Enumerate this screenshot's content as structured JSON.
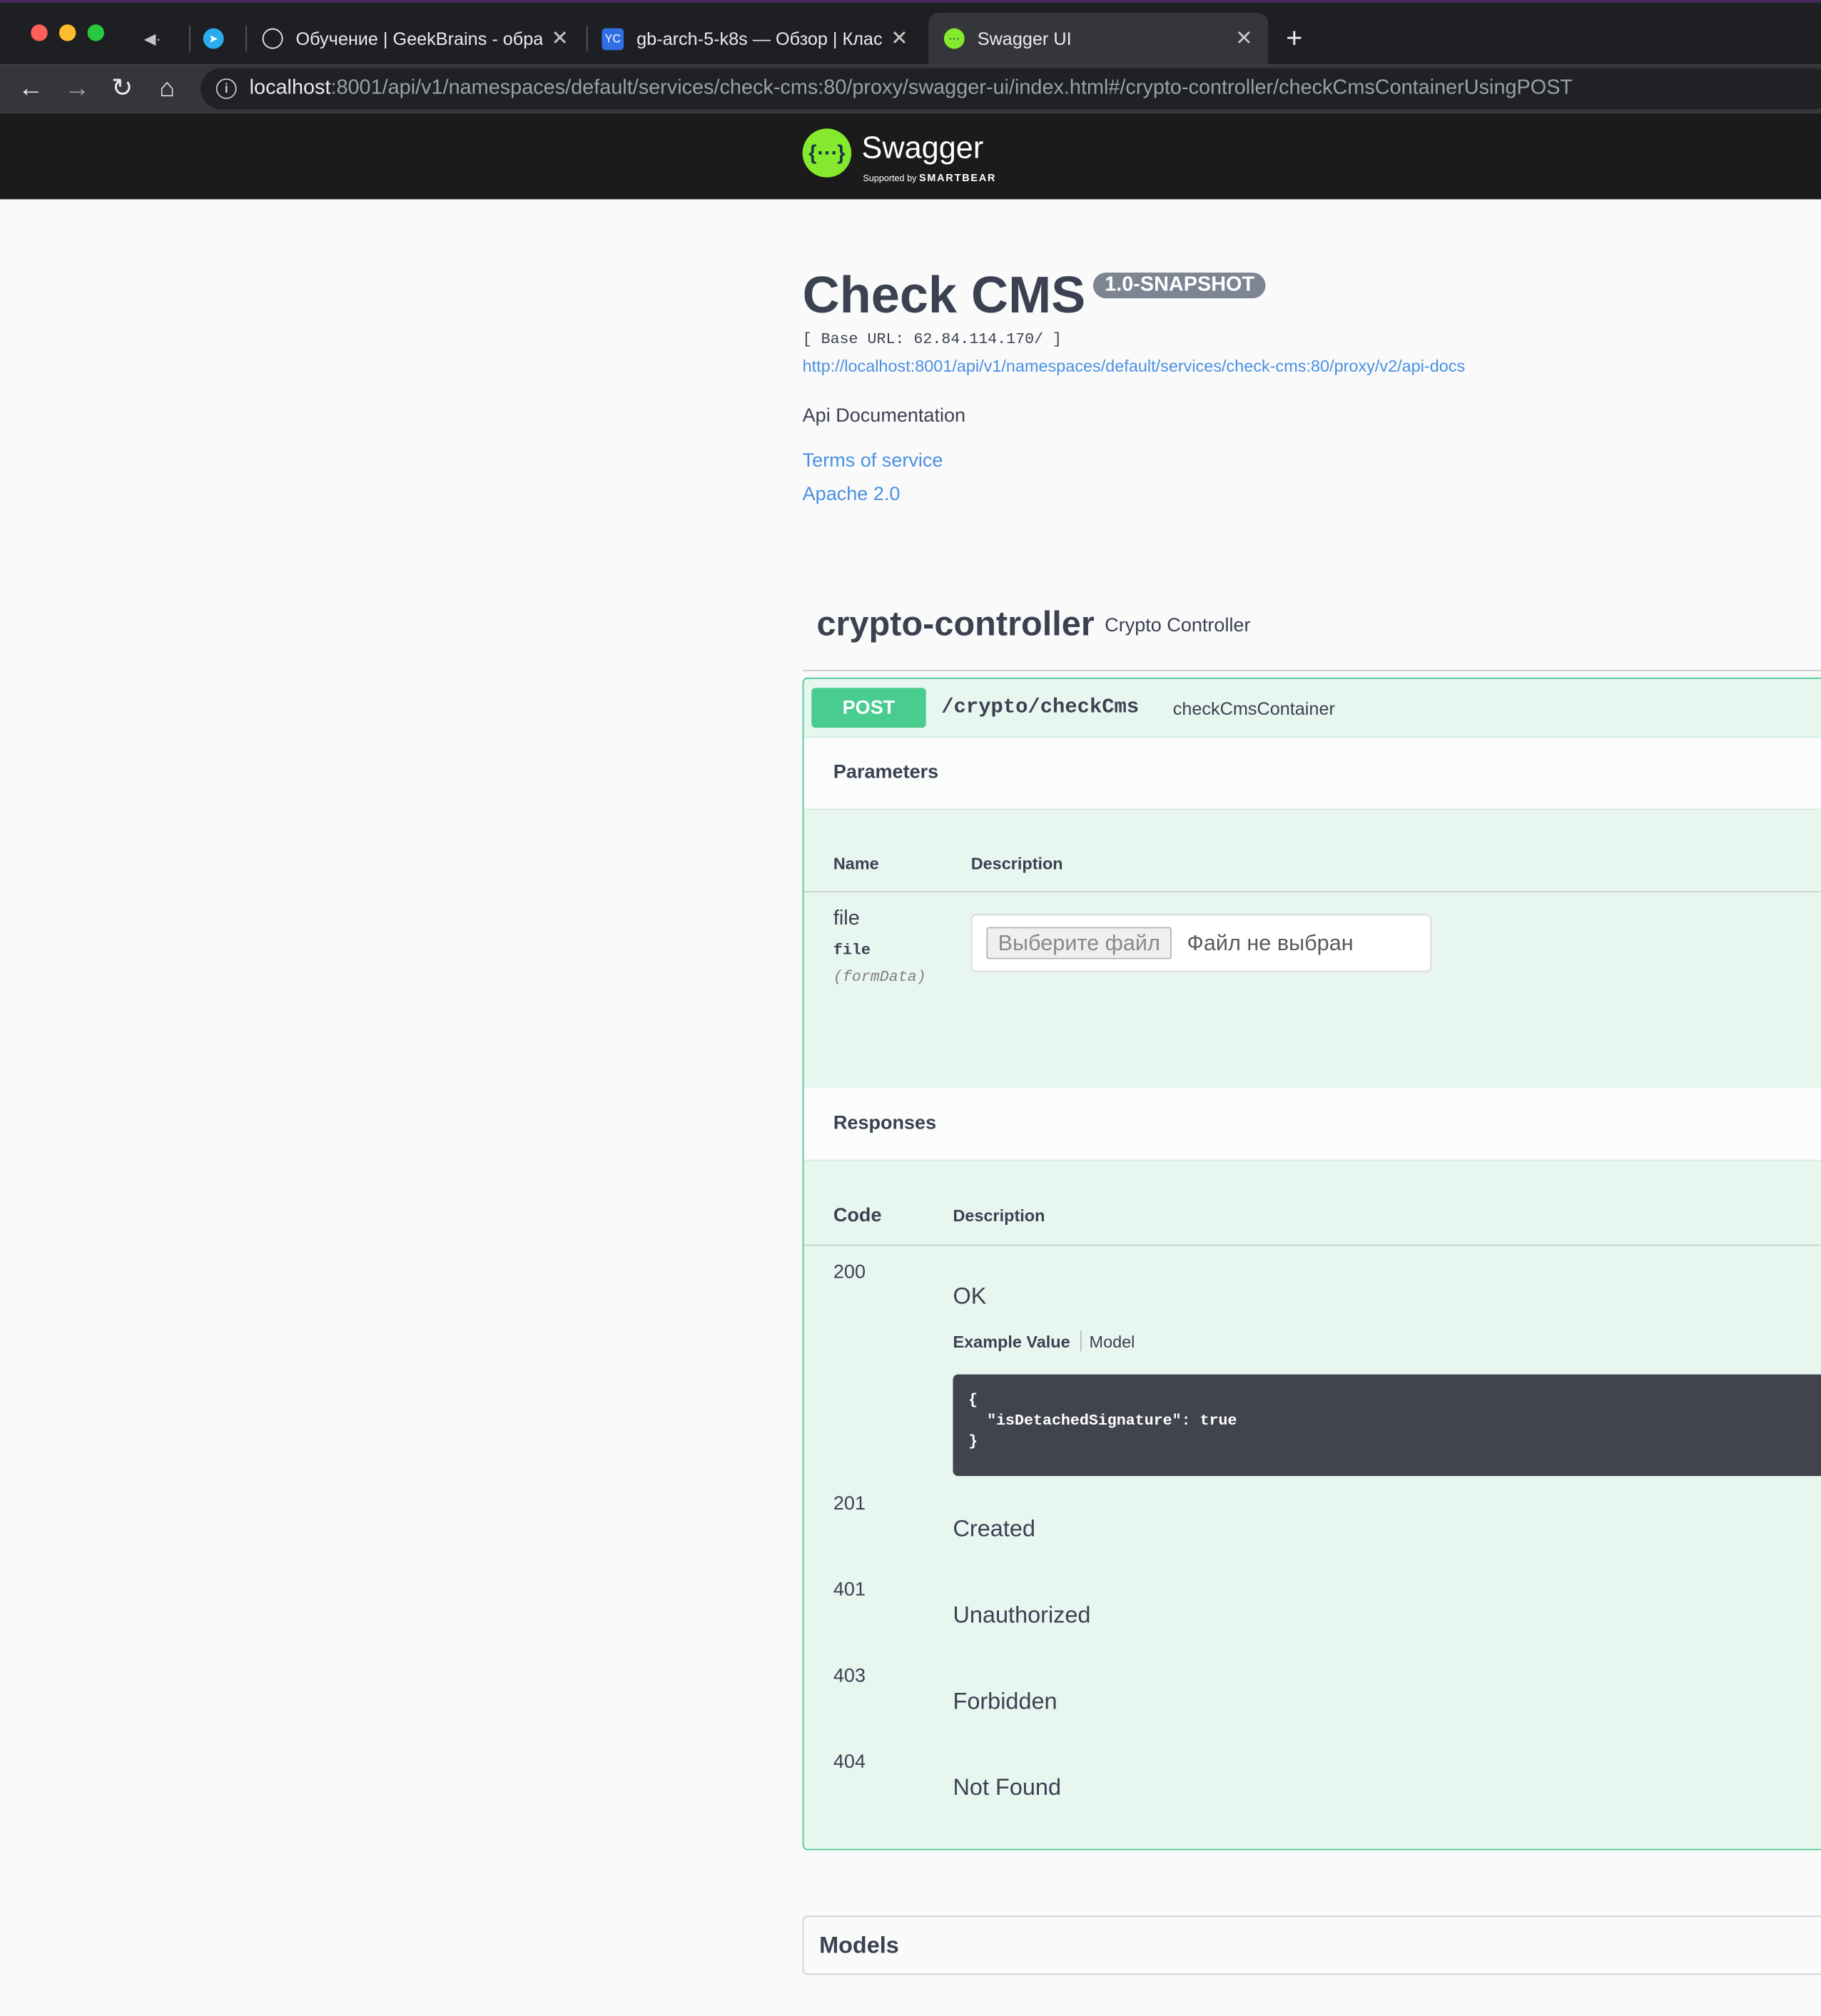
{
  "browser": {
    "tabs": [
      {
        "label": "",
        "icon": "speaker-icon"
      },
      {
        "label": "",
        "icon": "telegram-icon"
      },
      {
        "label": "Обучение | GeekBrains - обра",
        "icon": "openai-icon"
      },
      {
        "label": "gb-arch-5-k8s — Обзор | Клас",
        "icon": "yc-icon",
        "icon_text": "YC"
      },
      {
        "label": "Swagger UI",
        "icon": "swagger-icon",
        "active": true
      }
    ],
    "new_tab": "+",
    "url_host": "localhost",
    "url_path": ":8001/api/v1/namespaces/default/services/check-cms:80/proxy/swagger-ui/index.html#/crypto-controller/checkCmsContainerUsingPOST"
  },
  "topbar": {
    "logo_text": "Swagger",
    "logo_sub_prefix": "Supported by",
    "logo_sub_brand": "SMARTBEAR"
  },
  "info": {
    "title": "Check CMS",
    "version": "1.0-SNAPSHOT",
    "base_url": "[ Base URL: 62.84.114.170/ ]",
    "docs_url": "http://localhost:8001/api/v1/namespaces/default/services/check-cms:80/proxy/v2/api-docs",
    "description": "Api Documentation",
    "terms": "Terms of service",
    "license": "Apache 2.0"
  },
  "tag": {
    "name": "crypto-controller",
    "description": "Crypto Controller"
  },
  "operation": {
    "method": "POST",
    "path": "/crypto/checkCms",
    "summary": "checkCmsContainer",
    "parameters_title": "Parameters",
    "col_name": "Name",
    "col_description": "Description",
    "param": {
      "name": "file",
      "type": "file",
      "in": "(formData)",
      "button": "Выберите файл",
      "no_file": "Файл не выбран"
    },
    "responses_title": "Responses",
    "col_code": "Code",
    "col_resp_description": "Description",
    "example_value": "Example Value",
    "model": "Model",
    "example_body": "{\n  \"isDetachedSignature\": true\n}",
    "responses": [
      {
        "code": "200",
        "description": "OK"
      },
      {
        "code": "201",
        "description": "Created"
      },
      {
        "code": "401",
        "description": "Unauthorized"
      },
      {
        "code": "403",
        "description": "Forbidden"
      },
      {
        "code": "404",
        "description": "Not Found"
      }
    ]
  },
  "models": {
    "title": "Models"
  },
  "colors": {
    "post": "#49cc90",
    "link": "#4990e2",
    "logo": "#85ea2d"
  }
}
